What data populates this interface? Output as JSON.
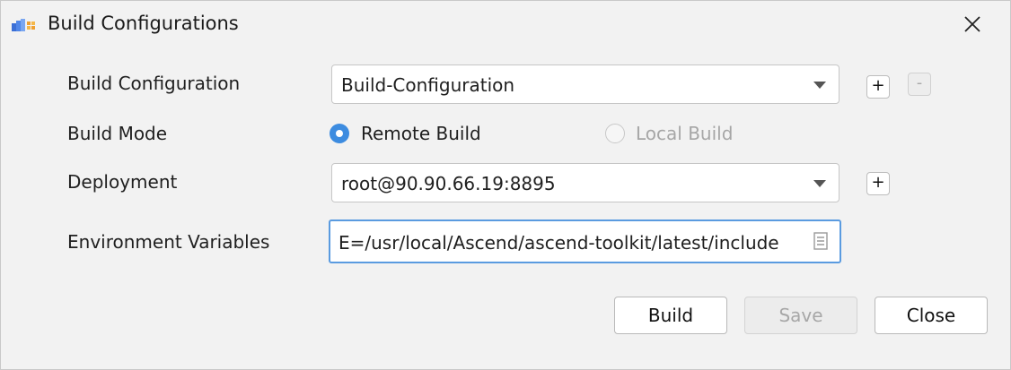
{
  "window": {
    "title": "Build Configurations",
    "app_icon": "build-config-icon",
    "close_icon": "close-icon"
  },
  "form": {
    "build_configuration": {
      "label": "Build Configuration",
      "value": "Build-Configuration",
      "add_label": "+",
      "remove_label": "-"
    },
    "build_mode": {
      "label": "Build Mode",
      "options": [
        {
          "label": "Remote Build",
          "selected": true,
          "enabled": true
        },
        {
          "label": "Local Build",
          "selected": false,
          "enabled": false
        }
      ]
    },
    "deployment": {
      "label": "Deployment",
      "value": "root@90.90.66.19:8895",
      "add_label": "+"
    },
    "environment_variables": {
      "label": "Environment Variables",
      "value": "E=/usr/local/Ascend/ascend-toolkit/latest/include"
    }
  },
  "buttons": {
    "build": "Build",
    "save": "Save",
    "close": "Close"
  },
  "colors": {
    "accent": "#3d8ce0",
    "focus_border": "#5a9be0",
    "disabled_text": "#a7a7a7"
  }
}
